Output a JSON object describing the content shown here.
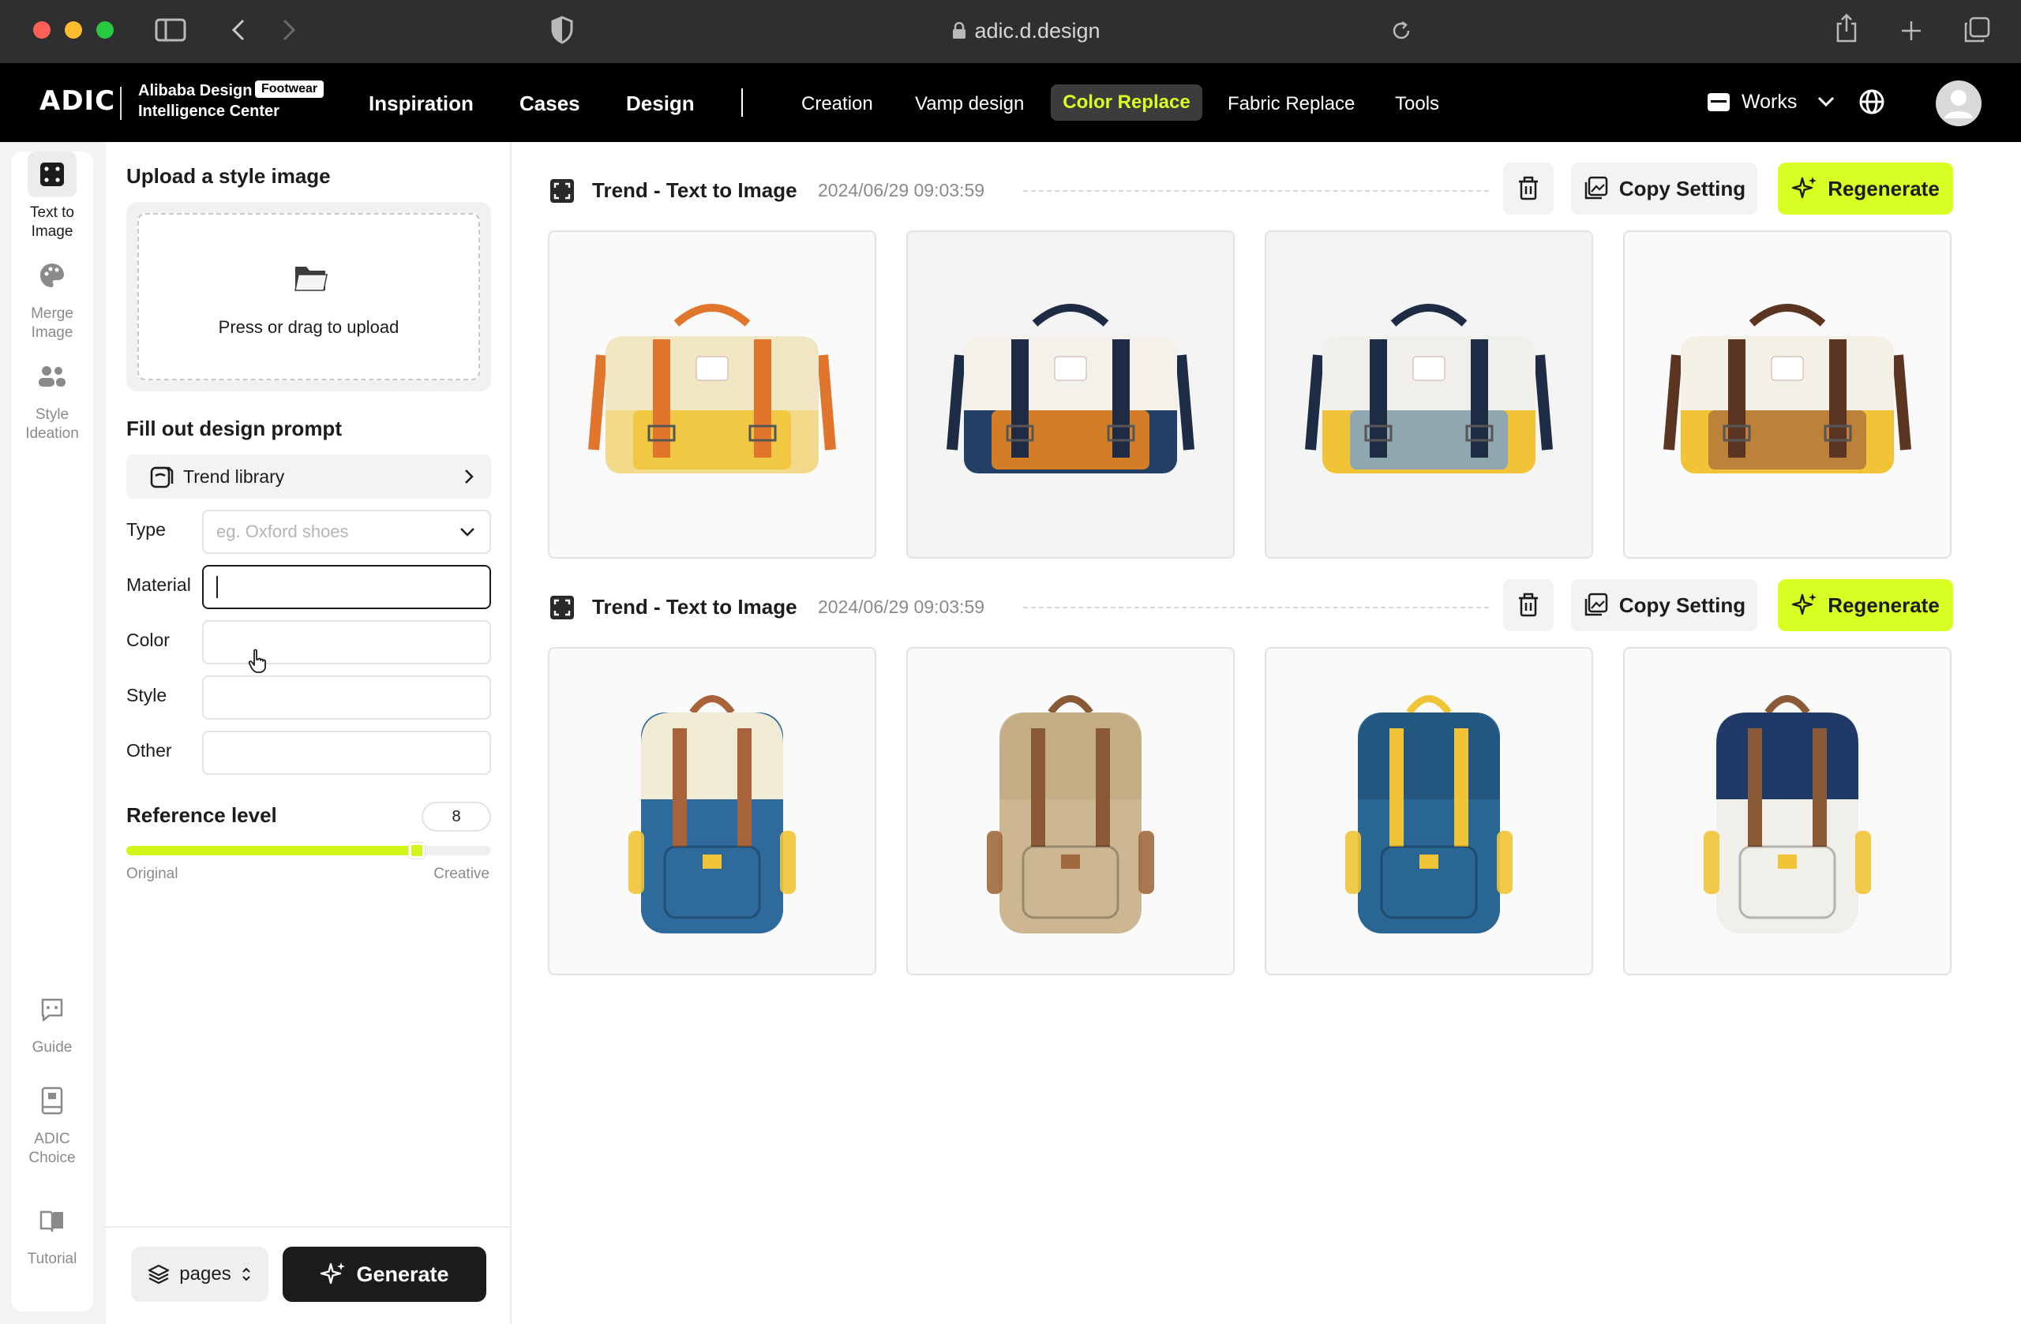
{
  "browser": {
    "url": "adic.d.design"
  },
  "header": {
    "logo": "ADIC",
    "brand_line1": "Alibaba Design",
    "brand_badge": "Footwear",
    "brand_line2": "Intelligence Center",
    "main_nav": [
      "Inspiration",
      "Cases",
      "Design"
    ],
    "sub_nav": [
      "Creation",
      "Vamp design",
      "Color Replace",
      "Fabric Replace",
      "Tools"
    ],
    "active_sub_nav": "Color Replace",
    "works_label": "Works"
  },
  "rail": {
    "items": [
      {
        "label_1": "Text to",
        "label_2": "Image",
        "icon": "dice-icon",
        "active": true
      },
      {
        "label_1": "Merge",
        "label_2": "Image",
        "icon": "palette-icon",
        "active": false
      },
      {
        "label_1": "Style",
        "label_2": "Ideation",
        "icon": "people-icon",
        "active": false
      },
      {
        "label_1": "Guide",
        "label_2": "",
        "icon": "chat-bot-icon",
        "active": false
      },
      {
        "label_1": "ADIC",
        "label_2": "Choice",
        "icon": "book-icon",
        "active": false
      },
      {
        "label_1": "Tutorial",
        "label_2": "",
        "icon": "open-book-icon",
        "active": false
      }
    ]
  },
  "panel": {
    "upload_heading": "Upload a style image",
    "upload_text": "Press or drag to upload",
    "prompt_heading": "Fill out design prompt",
    "trend_library": "Trend library",
    "fields": {
      "type_label": "Type",
      "type_placeholder": "eg. Oxford shoes",
      "material_label": "Material",
      "material_value": "",
      "color_label": "Color",
      "color_value": "",
      "style_label": "Style",
      "style_value": "",
      "other_label": "Other",
      "other_value": ""
    },
    "reference": {
      "heading": "Reference level",
      "value": "8",
      "level_fraction": 0.8,
      "min_label": "Original",
      "max_label": "Creative"
    },
    "footer": {
      "pages_label": "pages",
      "generate_label": "Generate"
    }
  },
  "results": [
    {
      "title": "Trend - Text to Image",
      "timestamp": "2024/06/29 09:03:59",
      "copy_label": "Copy Setting",
      "regenerate_label": "Regenerate",
      "images": [
        {
          "desc": "messenger bag",
          "body": "#f3d98a",
          "flap": "#f1e6c4",
          "strap": "#e0762b",
          "accent": "#f0c436"
        },
        {
          "desc": "messenger bag",
          "body": "#233f66",
          "flap": "#f3f1ea",
          "strap": "#1e2b44",
          "accent": "#f28a1c"
        },
        {
          "desc": "messenger bag",
          "body": "#f0c436",
          "flap": "#f1efea",
          "strap": "#1e2b44",
          "accent": "#7ea3c4"
        },
        {
          "desc": "messenger bag",
          "body": "#f0c436",
          "flap": "#f3f0e6",
          "strap": "#5b3522",
          "accent": "#b5763b"
        }
      ]
    },
    {
      "title": "Trend - Text to Image",
      "timestamp": "2024/06/29 09:03:59",
      "copy_label": "Copy Setting",
      "regenerate_label": "Regenerate",
      "images": [
        {
          "desc": "backpack",
          "body": "#2e6a9c",
          "flap": "#f1ebd6",
          "strap": "#a8633a",
          "accent": "#f0c436"
        },
        {
          "desc": "backpack",
          "body": "#cdb792",
          "flap": "#c4ac84",
          "strap": "#8a5a36",
          "accent": "#a06a3e"
        },
        {
          "desc": "backpack",
          "body": "#2a6694",
          "flap": "#24577f",
          "strap": "#f0c436",
          "accent": "#f0c436"
        },
        {
          "desc": "backpack",
          "body": "#f1efea",
          "flap": "#1f3a66",
          "strap": "#8a5a36",
          "accent": "#f0c436"
        }
      ]
    }
  ],
  "colors": {
    "accent": "#d7ff24",
    "dark": "#1c1c1c"
  }
}
